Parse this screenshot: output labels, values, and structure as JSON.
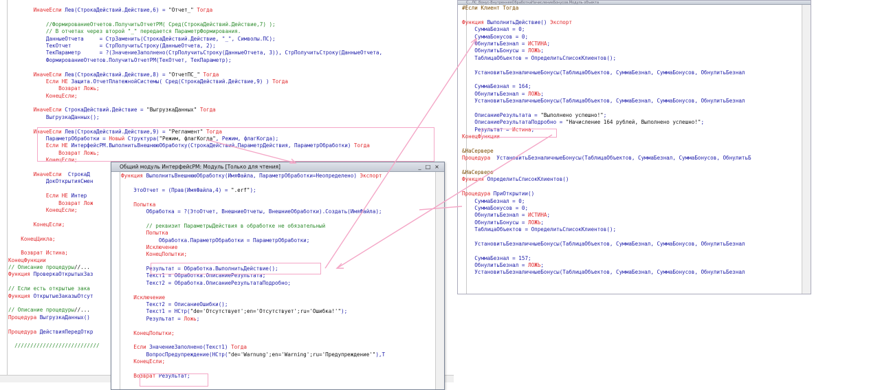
{
  "left_window": {
    "lines": [
      [
        {
          "t": "        "
        },
        {
          "c": "kw",
          "t": "ИначеЕсли "
        },
        {
          "c": "fn",
          "t": "Лев(СтрокаДействий.Действие,6) = "
        },
        {
          "c": "st",
          "t": "\"Отчет_\""
        },
        {
          "c": "kw",
          "t": " Тогда"
        }
      ],
      [
        {
          "t": ""
        }
      ],
      [
        {
          "t": "            "
        },
        {
          "c": "cm",
          "t": "//ФормированиеОтчетов.ПолучитьОтчетРМ( Сред(СтрокаДействий.Действие,7) );"
        }
      ],
      [
        {
          "t": "            "
        },
        {
          "c": "cm",
          "t": "// В отчетах через второй \"_\" передается ПараметрФормирования."
        }
      ],
      [
        {
          "t": "            "
        },
        {
          "c": "fn",
          "t": "ДанныеОтчета     = СтрЗаменить(СтрокаДействий.Действие, \"_\", Символы.ПС);"
        }
      ],
      [
        {
          "t": "            "
        },
        {
          "c": "fn",
          "t": "ТекОтчет         = СтрПолучитьСтроку(ДанныеОтчета, 2);"
        }
      ],
      [
        {
          "t": "            "
        },
        {
          "c": "fn",
          "t": "ТекПараметр      = ?(ЗначениеЗаполнено(СтрПолучитьСтроку(ДанныеОтчета, 3)), СтрПолучитьСтроку(ДанныеОтчета,"
        }
      ],
      [
        {
          "t": "            "
        },
        {
          "c": "fn",
          "t": "ФормированиеОтчетов.ПолучитьОтчетРМ(ТекОтчет, ТекПараметр);"
        }
      ],
      [
        {
          "t": ""
        }
      ],
      [
        {
          "t": "        "
        },
        {
          "c": "kw",
          "t": "ИначеЕсли "
        },
        {
          "c": "fn",
          "t": "Лев(СтрокаДействий.Действие,8) = "
        },
        {
          "c": "st",
          "t": "\"ОтчетПС_\""
        },
        {
          "c": "kw",
          "t": " Тогда"
        }
      ],
      [
        {
          "t": "            "
        },
        {
          "c": "kw",
          "t": "Если НЕ "
        },
        {
          "c": "fn",
          "t": "Защита.ОтчетПлатежнойСистемы( Сред(СтрокаДействий.Действие,9) ) "
        },
        {
          "c": "kw",
          "t": "Тогда"
        }
      ],
      [
        {
          "t": "                "
        },
        {
          "c": "kw",
          "t": "Возврат Ложь;"
        }
      ],
      [
        {
          "t": "            "
        },
        {
          "c": "kw",
          "t": "КонецЕсли;"
        }
      ],
      [
        {
          "t": ""
        }
      ],
      [
        {
          "t": "        "
        },
        {
          "c": "kw",
          "t": "ИначеЕсли "
        },
        {
          "c": "fn",
          "t": "СтрокаДействий.Действие = "
        },
        {
          "c": "st",
          "t": "\"ВыгрузкаДанных\""
        },
        {
          "c": "kw",
          "t": " Тогда"
        }
      ],
      [
        {
          "t": "            "
        },
        {
          "c": "fn",
          "t": "ВыгрузкаДанных();"
        }
      ],
      [
        {
          "t": ""
        }
      ],
      [
        {
          "t": "        "
        },
        {
          "c": "kw",
          "t": "ИначеЕсли "
        },
        {
          "c": "fn",
          "t": "Лев(СтрокаДействий.Действие,9) = "
        },
        {
          "c": "st",
          "t": "\"Регламент\""
        },
        {
          "c": "kw",
          "t": " Тогда"
        }
      ],
      [
        {
          "t": "            "
        },
        {
          "c": "fn",
          "t": "ПараметрОбработки = "
        },
        {
          "c": "kw",
          "t": "Новый "
        },
        {
          "c": "fn",
          "t": "Структура("
        },
        {
          "c": "st",
          "t": "\"Режим, флагКогда\""
        },
        {
          "c": "fn",
          "t": ", Режим, флагКогда);"
        }
      ],
      [
        {
          "t": "            "
        },
        {
          "c": "kw",
          "t": "Если НЕ "
        },
        {
          "c": "fn",
          "t": "ИнтерфейсРМ.ВыполнитьВнешнююОбработку(СтрокаДействий.ПараметрДействия, ПараметрОбработки) "
        },
        {
          "c": "kw",
          "t": "Тогда"
        }
      ],
      [
        {
          "t": "                "
        },
        {
          "c": "kw",
          "t": "Возврат Ложь;"
        }
      ],
      [
        {
          "t": "            "
        },
        {
          "c": "kw",
          "t": "КонецЕсли;"
        }
      ],
      [
        {
          "t": ""
        }
      ],
      [
        {
          "t": "        "
        },
        {
          "c": "kw",
          "t": "ИначеЕсли  "
        },
        {
          "c": "fn",
          "t": "СтрокаД"
        }
      ],
      [
        {
          "t": "            "
        },
        {
          "c": "fn",
          "t": "ДокОткрытияСмен"
        }
      ],
      [
        {
          "t": ""
        }
      ],
      [
        {
          "t": "            "
        },
        {
          "c": "kw",
          "t": "Если НЕ "
        },
        {
          "c": "fn",
          "t": "Интер"
        }
      ],
      [
        {
          "t": "                "
        },
        {
          "c": "kw",
          "t": "Возврат Лож"
        }
      ],
      [
        {
          "t": "            "
        },
        {
          "c": "kw",
          "t": "КонецЕсли;"
        }
      ],
      [
        {
          "t": ""
        }
      ],
      [
        {
          "t": "        "
        },
        {
          "c": "kw",
          "t": "КонецЕсли;"
        }
      ],
      [
        {
          "t": ""
        }
      ],
      [
        {
          "t": "    "
        },
        {
          "c": "kw",
          "t": "КонецЦикла;"
        }
      ],
      [
        {
          "t": ""
        }
      ],
      [
        {
          "t": "    "
        },
        {
          "c": "kw",
          "t": "Возврат Истина;"
        }
      ],
      [
        {
          "c": "kw",
          "t": "КонецФункции"
        }
      ],
      [
        {
          "c": "cm",
          "t": "// Описание процедуры"
        },
        {
          "c": "nm",
          "t": "//..."
        }
      ],
      [
        {
          "c": "kw",
          "t": "Функция "
        },
        {
          "c": "fn",
          "t": "ПроверкаОткрытыхЗаз"
        }
      ],
      [
        {
          "t": ""
        }
      ],
      [
        {
          "c": "cm",
          "t": "// Если есть открытые зака"
        }
      ],
      [
        {
          "c": "kw",
          "t": "Функция "
        },
        {
          "c": "fn",
          "t": "ОткрытыеЗаказыОтсут"
        }
      ],
      [
        {
          "t": ""
        }
      ],
      [
        {
          "c": "cm",
          "t": "// Описание процедуры"
        },
        {
          "c": "nm",
          "t": "//..."
        }
      ],
      [
        {
          "c": "kw",
          "t": "Процедура "
        },
        {
          "c": "fn",
          "t": "ВыгрузкаДанных()"
        }
      ],
      [
        {
          "t": ""
        }
      ],
      [
        {
          "c": "kw",
          "t": "Процедура "
        },
        {
          "c": "fn",
          "t": "ДействияПередОткр"
        }
      ],
      [
        {
          "t": ""
        }
      ],
      [
        {
          "c": "cm",
          "t": "  ///////////////////////////"
        }
      ]
    ]
  },
  "middle_window": {
    "title": "Общий модуль ИнтерфейсРМ: Модуль [Только для чтения]",
    "btn_min": "_",
    "btn_max": "□",
    "btn_close": "×",
    "lines": [
      [
        {
          "c": "kw",
          "t": "Функция "
        },
        {
          "c": "fn",
          "t": "ВыполнитьВнешнююОбработку(ИмяФайла, ПараметрОбработки=Неопределено) "
        },
        {
          "c": "kw",
          "t": "Экспорт"
        }
      ],
      [
        {
          "t": ""
        }
      ],
      [
        {
          "t": "    "
        },
        {
          "c": "fn",
          "t": "ЭтоОтчет = (Прав(ИмяФайла,4) = "
        },
        {
          "c": "st",
          "t": "\".erf\""
        },
        {
          "c": "fn",
          "t": ");"
        }
      ],
      [
        {
          "t": ""
        }
      ],
      [
        {
          "t": "    "
        },
        {
          "c": "kw",
          "t": "Попытка"
        }
      ],
      [
        {
          "t": "        "
        },
        {
          "c": "fn",
          "t": "Обработка = ?(ЭтоОтчет, ВнешниеОтчеты, ВнешниеОбработки).Создать(ИмяФайла);"
        }
      ],
      [
        {
          "t": ""
        }
      ],
      [
        {
          "t": "        "
        },
        {
          "c": "cm",
          "t": "// реквизит ПараметрыДействия в обработке не обязательный"
        }
      ],
      [
        {
          "t": "        "
        },
        {
          "c": "kw",
          "t": "Попытка"
        }
      ],
      [
        {
          "t": "            "
        },
        {
          "c": "fn",
          "t": "Обработка.ПараметрОбработки = ПараметрОбработки;"
        }
      ],
      [
        {
          "t": "        "
        },
        {
          "c": "kw",
          "t": "Исключение"
        }
      ],
      [
        {
          "t": "        "
        },
        {
          "c": "kw",
          "t": "КонецПопытки;"
        }
      ],
      [
        {
          "t": ""
        }
      ],
      [
        {
          "t": "        "
        },
        {
          "c": "fn",
          "t": "Результат = Обработка.ВыполнитьДействие();"
        }
      ],
      [
        {
          "t": "        "
        },
        {
          "c": "fn",
          "t": "Текст1 = Обработка.ОписаниеРезультата;"
        }
      ],
      [
        {
          "t": "        "
        },
        {
          "c": "fn",
          "t": "Текст2 = Обработка.ОписаниеРезультатаПодробно;"
        }
      ],
      [
        {
          "t": ""
        }
      ],
      [
        {
          "t": "    "
        },
        {
          "c": "kw",
          "t": "Исключение"
        }
      ],
      [
        {
          "t": "        "
        },
        {
          "c": "fn",
          "t": "Текст2 = ОписаниеОшибки();"
        }
      ],
      [
        {
          "t": "        "
        },
        {
          "c": "fn",
          "t": "Текст1 = НСтр("
        },
        {
          "c": "st",
          "t": "\"de='Отсутствует';en='Отсутствует';ru='Ошибка!'\""
        },
        {
          "c": "fn",
          "t": ");"
        }
      ],
      [
        {
          "t": "        "
        },
        {
          "c": "fn",
          "t": "Результат = "
        },
        {
          "c": "kw",
          "t": "Ложь"
        },
        {
          "c": "fn",
          "t": ";"
        }
      ],
      [
        {
          "t": ""
        }
      ],
      [
        {
          "t": "    "
        },
        {
          "c": "kw",
          "t": "КонецПопытки;"
        }
      ],
      [
        {
          "t": ""
        }
      ],
      [
        {
          "t": "    "
        },
        {
          "c": "kw",
          "t": "Если "
        },
        {
          "c": "fn",
          "t": "ЗначениеЗаполнено(Текст1) "
        },
        {
          "c": "kw",
          "t": "Тогда"
        }
      ],
      [
        {
          "t": "        "
        },
        {
          "c": "fn",
          "t": "ВопросПредупреждение(НСтр("
        },
        {
          "c": "st",
          "t": "\"de='Warnung';en='Warning';ru='Предупреждение'\""
        },
        {
          "c": "fn",
          "t": "),Т"
        }
      ],
      [
        {
          "t": "    "
        },
        {
          "c": "kw",
          "t": "КонецЕсли;"
        }
      ],
      [
        {
          "t": ""
        }
      ],
      [
        {
          "t": "    "
        },
        {
          "c": "kw",
          "t": "Возврат "
        },
        {
          "c": "fn",
          "t": "Результат;"
        }
      ]
    ]
  },
  "right_window": {
    "title": "С...ЛС_Bонус-ВнутренняяОбработкаНачислениеБонусов.Модуль объекта",
    "lines": [
      [
        {
          "c": "pp",
          "t": "#Если Клиент Тогда"
        }
      ],
      [
        {
          "t": ""
        }
      ],
      [
        {
          "c": "kw",
          "t": "Функция "
        },
        {
          "c": "fn",
          "t": "ВыполнитьДействие() "
        },
        {
          "c": "kw",
          "t": "Экспорт"
        }
      ],
      [
        {
          "t": "    "
        },
        {
          "c": "fn",
          "t": "СуммаБезнал = 0;"
        }
      ],
      [
        {
          "t": "    "
        },
        {
          "c": "fn",
          "t": "СуммаБонусов = 0;"
        }
      ],
      [
        {
          "t": "    "
        },
        {
          "c": "fn",
          "t": "ОбнулитьБезнал = "
        },
        {
          "c": "kw",
          "t": "ИСТИНА"
        },
        {
          "c": "fn",
          "t": ";"
        }
      ],
      [
        {
          "t": "    "
        },
        {
          "c": "fn",
          "t": "ОбнулитьБонусы = "
        },
        {
          "c": "kw",
          "t": "ЛОЖЬ"
        },
        {
          "c": "fn",
          "t": ";"
        }
      ],
      [
        {
          "t": "    "
        },
        {
          "c": "fn",
          "t": "ТаблицаОбъектов = ОпределитьСписокКлиентов();"
        }
      ],
      [
        {
          "t": ""
        }
      ],
      [
        {
          "t": "    "
        },
        {
          "c": "fn",
          "t": "УстановитьБезналичныеБонусы(ТаблицаОбъектов, СуммаБезнал, СуммаБонусов, ОбнулитьБезнал"
        }
      ],
      [
        {
          "t": ""
        }
      ],
      [
        {
          "t": "    "
        },
        {
          "c": "fn",
          "t": "СуммаБезнал = 164;"
        }
      ],
      [
        {
          "t": "    "
        },
        {
          "c": "fn",
          "t": "ОбнулитьБезнал = "
        },
        {
          "c": "kw",
          "t": "ЛОЖЬ"
        },
        {
          "c": "fn",
          "t": ";"
        }
      ],
      [
        {
          "t": "    "
        },
        {
          "c": "fn",
          "t": "УстановитьБезналичныеБонусы(ТаблицаОбъектов, СуммаБезнал, СуммаБонусов, ОбнулитьБезнал"
        }
      ],
      [
        {
          "t": ""
        }
      ],
      [
        {
          "t": "    "
        },
        {
          "c": "fn",
          "t": "ОписаниеРезультата = "
        },
        {
          "c": "st",
          "t": "\"Выполнено успешно!\""
        },
        {
          "c": "fn",
          "t": ";"
        }
      ],
      [
        {
          "t": "    "
        },
        {
          "c": "fn",
          "t": "ОписаниеРезультатаПодробно = "
        },
        {
          "c": "st",
          "t": "\"Начисление 164 рублей, Выполнено успешно!\""
        },
        {
          "c": "fn",
          "t": ";"
        }
      ],
      [
        {
          "t": "    "
        },
        {
          "c": "fn",
          "t": "Результат = "
        },
        {
          "c": "kw",
          "t": "Истина"
        },
        {
          "c": "fn",
          "t": ";"
        }
      ],
      [
        {
          "c": "kw",
          "t": "КонецФункции"
        }
      ],
      [
        {
          "t": ""
        }
      ],
      [
        {
          "c": "pp",
          "t": "&НаСервере"
        }
      ],
      [
        {
          "c": "kw",
          "t": "Процедура  "
        },
        {
          "c": "fn",
          "t": "УстановитьБезналичныеБонусы(ТаблицаОбъектов, СуммаБезнал, СуммаБонусов, ОбнулитьБ"
        }
      ],
      [
        {
          "t": ""
        }
      ],
      [
        {
          "c": "pp",
          "t": "&НаСервере"
        }
      ],
      [
        {
          "c": "kw",
          "t": "Функция "
        },
        {
          "c": "fn",
          "t": "ОпределитьСписокКлиентов()  "
        }
      ],
      [
        {
          "t": ""
        }
      ],
      [
        {
          "c": "kw",
          "t": "Процедура "
        },
        {
          "c": "fn",
          "t": "ПриОткрытии()"
        }
      ],
      [
        {
          "t": "    "
        },
        {
          "c": "fn",
          "t": "СуммаБезнал = 0;"
        }
      ],
      [
        {
          "t": "    "
        },
        {
          "c": "fn",
          "t": "СуммаБонусов = 0;"
        }
      ],
      [
        {
          "t": "    "
        },
        {
          "c": "fn",
          "t": "ОбнулитьБезнал = "
        },
        {
          "c": "kw",
          "t": "ИСТИНА"
        },
        {
          "c": "fn",
          "t": ";"
        }
      ],
      [
        {
          "t": "    "
        },
        {
          "c": "fn",
          "t": "ОбнулитьБонусы = "
        },
        {
          "c": "kw",
          "t": "ЛОЖЬ"
        },
        {
          "c": "fn",
          "t": ";"
        }
      ],
      [
        {
          "t": "    "
        },
        {
          "c": "fn",
          "t": "ТаблицаОбъектов = ОпределитьСписокКлиентов();"
        }
      ],
      [
        {
          "t": ""
        }
      ],
      [
        {
          "t": "    "
        },
        {
          "c": "fn",
          "t": "УстановитьБезналичныеБонусы(ТаблицаОбъектов, СуммаБезнал, СуммаБонусов, ОбнулитьБезнал"
        }
      ],
      [
        {
          "t": ""
        }
      ],
      [
        {
          "t": "    "
        },
        {
          "c": "fn",
          "t": "СуммаБезнал = 157;"
        }
      ],
      [
        {
          "t": "    "
        },
        {
          "c": "fn",
          "t": "ОбнулитьБезнал = "
        },
        {
          "c": "kw",
          "t": "ЛОЖЬ"
        },
        {
          "c": "fn",
          "t": ";"
        }
      ],
      [
        {
          "t": "    "
        },
        {
          "c": "fn",
          "t": "УстановитьБезналичныеБонусы(ТаблицаОбъектов, СуммаБезнал, СуммаБонусов, ОбнулитьБезнал"
        }
      ]
    ]
  },
  "colors": {
    "keyword": "#e0282b",
    "identifier": "#1a1aa8",
    "comment": "#2a8a2a",
    "highlight": "#f4a6c6"
  }
}
